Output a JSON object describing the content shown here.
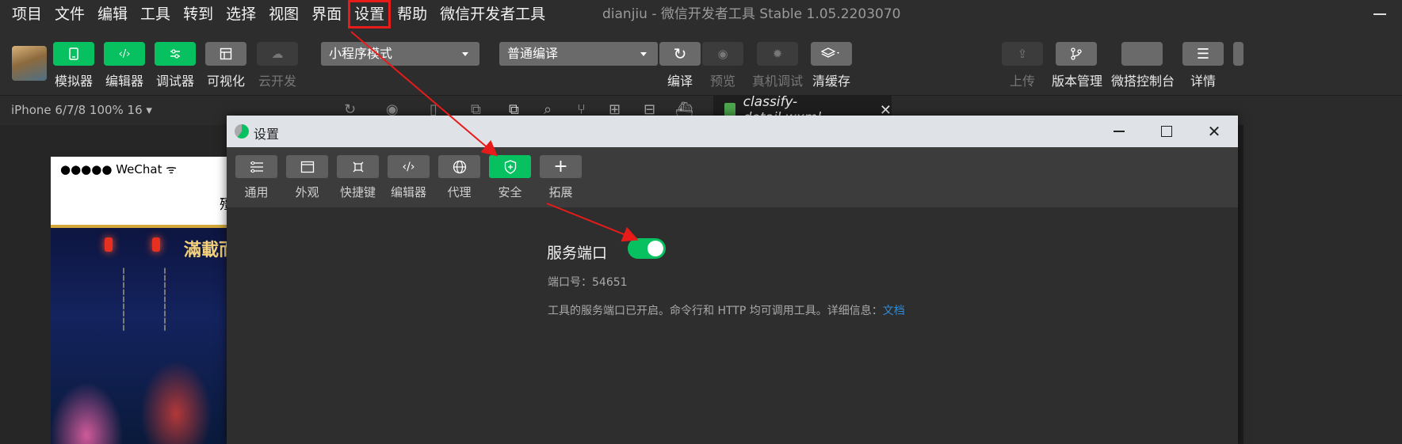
{
  "menu": {
    "items": [
      "项目",
      "文件",
      "编辑",
      "工具",
      "转到",
      "选择",
      "视图",
      "界面",
      "设置",
      "帮助",
      "微信开发者工具"
    ],
    "highlighted_index": 8
  },
  "window_title": "dianjiu - 微信开发者工具 Stable 1.05.2203070",
  "toolbar": {
    "simulator": "模拟器",
    "editor": "编辑器",
    "debugger": "调试器",
    "visual": "可视化",
    "cloud": "云开发",
    "mode_select": "小程序模式",
    "compile_select": "普通编译",
    "compile": "编译",
    "preview": "预览",
    "real_debug": "真机调试",
    "clear_cache": "清缓存",
    "upload": "上传",
    "version": "版本管理",
    "console": "微搭控制台",
    "details": "详情"
  },
  "strip": {
    "device": "iPhone 6/7/8 100% 16 ▾",
    "file_tab": "classify-detail.wxml"
  },
  "simulator": {
    "status": "●●●●● WeChat",
    "nav_fragment": "殭",
    "image_title": "滿載而"
  },
  "dialog": {
    "title": "设置",
    "tabs": [
      {
        "label": "通用",
        "icon": "sliders-icon"
      },
      {
        "label": "外观",
        "icon": "window-icon"
      },
      {
        "label": "快捷键",
        "icon": "command-icon"
      },
      {
        "label": "编辑器",
        "icon": "code-icon"
      },
      {
        "label": "代理",
        "icon": "globe-icon"
      },
      {
        "label": "安全",
        "icon": "shield-icon"
      },
      {
        "label": "拓展",
        "icon": "plus-icon"
      }
    ],
    "active_tab": 5,
    "service_port_label": "服务端口",
    "service_port_enabled": true,
    "port_text": "端口号：54651",
    "description": "工具的服务端口已开启。命令行和 HTTP 均可调用工具。详细信息：",
    "doc_link": "文档"
  },
  "colors": {
    "accent_green": "#07c160",
    "highlight_red": "#e81b1b",
    "link_blue": "#2e8bd8"
  }
}
